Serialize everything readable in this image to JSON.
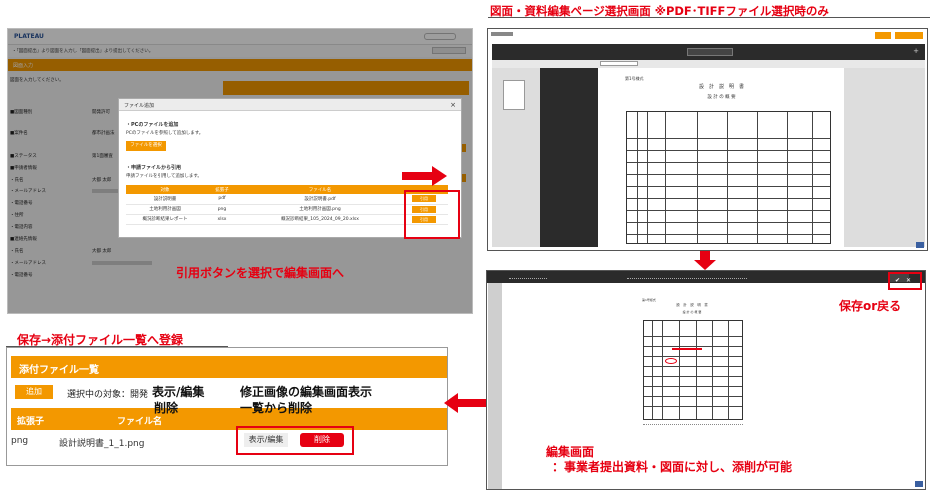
{
  "headings": {
    "top_right": "図面・資料編集ページ選択画面 ※PDF･TIFFファイル選択時のみ",
    "bottom_left": "保存→添付ファイル一覧へ登録"
  },
  "annotations": {
    "cite_to_edit": "引用ボタンを選択で編集画面へ",
    "save_or_back": "保存or戻る",
    "edit_title": "編集画面",
    "edit_desc": "：事業者提出資料・図面に対し、添削が可能",
    "view_edit_line1": "表示/編集",
    "view_edit_line2": "削除",
    "view_edit_desc1": "修正画像の編集画面表示",
    "view_edit_desc2": "一覧から削除"
  },
  "left_window": {
    "logo": "PLATEAU",
    "notice": "・「図面提出」より図面を入力し「図面提出」より提出してください。",
    "section_bar": "図面入力",
    "fields": [
      "■図面種別",
      "■案件名",
      "■ステータス",
      "■申請者情報",
      "・氏名",
      "・メールアドレス",
      "・電話番号",
      "・住所",
      "・電話内容",
      "■連絡先情報",
      "・氏名",
      "・メールアドレス",
      "・電話番号"
    ],
    "values": [
      "開発許可",
      "都市計画法",
      "第1面審査",
      "大都 太郎",
      "大都 太郎"
    ]
  },
  "modal": {
    "title": "ファイル追加",
    "pc_heading": "・PCのファイルを追加",
    "pc_desc": "PCのファイルを参照して追加します。",
    "pc_button": "ファイルを選択",
    "cite_heading": "・申請ファイルから引用",
    "cite_desc": "申請ファイルを引用して追加します。",
    "columns": [
      "対象",
      "拡張子",
      "ファイル名",
      ""
    ],
    "rows": [
      {
        "target": "設計説明書",
        "ext": "pdf",
        "name": "設計説明書.pdf",
        "btn": "引用"
      },
      {
        "target": "土地利用計画図",
        "ext": "png",
        "name": "土地利用計画図.png",
        "btn": "引用"
      },
      {
        "target": "概況診断結果レポート",
        "ext": "xlsx",
        "name": "概況診断結果_105_2024_09_20.xlsx",
        "btn": "引用"
      }
    ]
  },
  "attach_panel": {
    "title": "添付ファイル一覧",
    "add_button": "追加",
    "selected_label": "選択中の対象：開発",
    "columns": [
      "拡張子",
      "ファイル名"
    ],
    "row": {
      "ext": "png",
      "name": "設計説明書_1_1.png",
      "view_button": "表示/編集",
      "delete_button": "削除"
    }
  },
  "doc": {
    "form_no": "第1号様式",
    "title": "設　計　説　明　書",
    "subtitle": "設 計 の 概 要"
  },
  "colors": {
    "accent": "#f39800",
    "highlight": "#e60012"
  }
}
